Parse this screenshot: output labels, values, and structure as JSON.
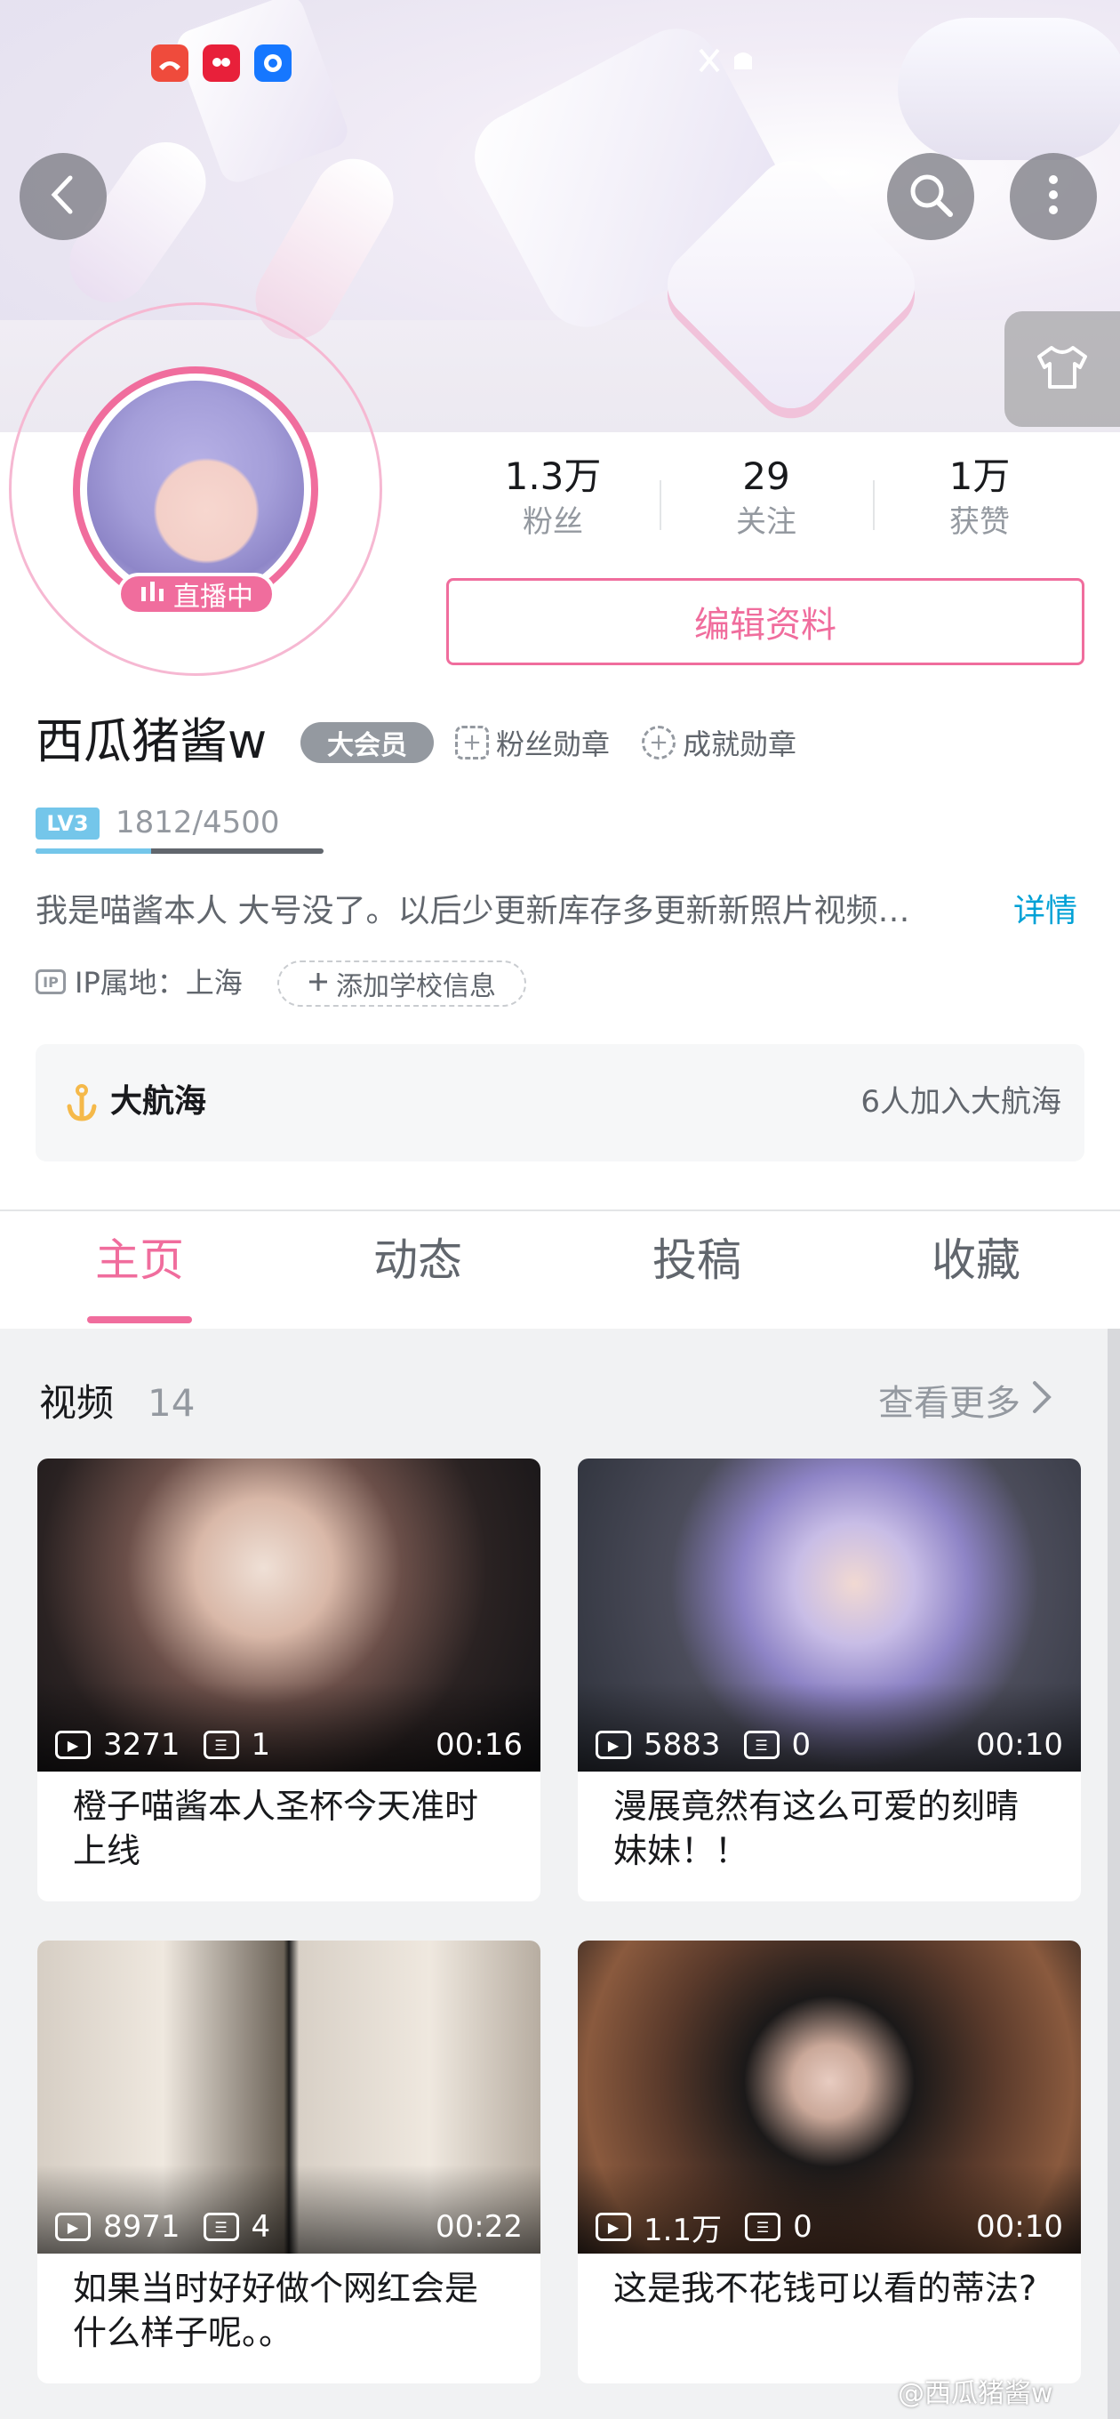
{
  "status_bar": {
    "apps": [
      "phone-missed-icon",
      "shopping-app-icon",
      "chat-app-icon"
    ]
  },
  "header": {
    "back_icon": "back-icon",
    "search_icon": "search-icon",
    "more_icon": "more-icon",
    "closet_icon": "tshirt-icon"
  },
  "profile": {
    "live_label": "直播中",
    "stats": [
      {
        "value": "1.3万",
        "label": "粉丝"
      },
      {
        "value": "29",
        "label": "关注"
      },
      {
        "value": "1万",
        "label": "获赞"
      }
    ],
    "edit_label": "编辑资料",
    "username": "西瓜猪酱w",
    "vip_label": "大会员",
    "fan_medal_label": "粉丝勋章",
    "achievement_label": "成就勋章",
    "level_badge": "LV3",
    "level_progress_text": "1812/4500",
    "level_progress": 0.4027,
    "bio": "我是喵酱本人 大号没了。以后少更新库存多更新新照片视频…",
    "bio_more": "详情",
    "ip_icon": "IP",
    "ip_text": "IP属地：上海",
    "school_label": "添加学校信息",
    "voyage_title": "大航海",
    "voyage_count": "6人加入大航海"
  },
  "tabs": [
    {
      "label": "主页",
      "active": true
    },
    {
      "label": "动态",
      "active": false
    },
    {
      "label": "投稿",
      "active": false
    },
    {
      "label": "收藏",
      "active": false
    }
  ],
  "videos": {
    "title": "视频",
    "count": "14",
    "see_more": "查看更多",
    "items": [
      {
        "title": "橙子喵酱本人圣杯今天准时上线",
        "plays": "3271",
        "comments": "1",
        "duration": "00:16"
      },
      {
        "title": "漫展竟然有这么可爱的刻晴妹妹！！",
        "plays": "5883",
        "comments": "0",
        "duration": "00:10"
      },
      {
        "title": "如果当时好好做个网红会是什么样子呢。。",
        "plays": "8971",
        "comments": "4",
        "duration": "00:22"
      },
      {
        "title": "这是我不花钱可以看的蒂法?",
        "plays": "1.1万",
        "comments": "0",
        "duration": "00:10"
      }
    ]
  },
  "watermark": "@西瓜猪酱w",
  "colors": {
    "accent": "#f06d9d",
    "link": "#00a1d6",
    "level": "#74c6ea",
    "voyage": "#f5b94a"
  }
}
